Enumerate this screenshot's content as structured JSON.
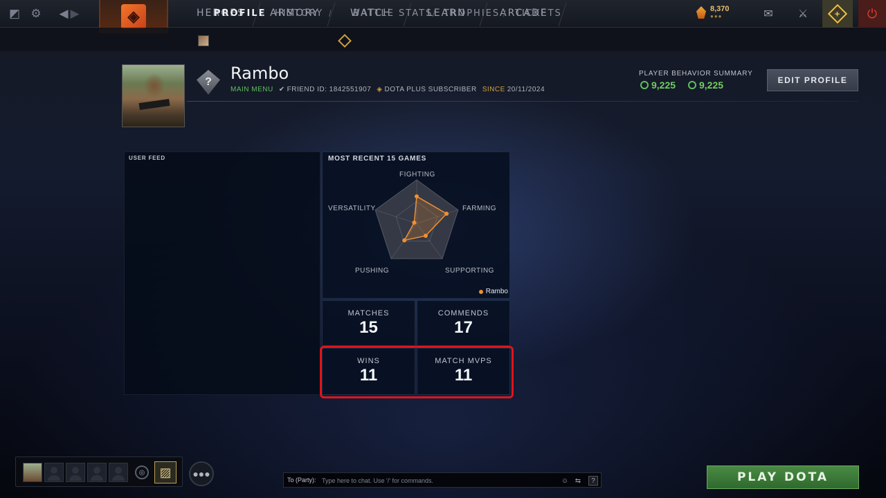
{
  "nav": {
    "items": [
      "HEROES",
      "ARMORY",
      "WATCH",
      "LEARN",
      "ARCADE"
    ],
    "currency": "8,370",
    "icons": [
      "dota-logo-icon",
      "settings-gear-icon",
      "back-arrow-icon",
      "forward-arrow-icon",
      "mail-icon",
      "armory-icon",
      "dota-plus-icon",
      "power-icon"
    ]
  },
  "subnav": {
    "profile": "PROFILE",
    "history": "HISTORY",
    "battle_stats": "BATTLE STATS",
    "trophies": "TROPHIES",
    "tickets": "TICKETS"
  },
  "profile": {
    "name": "Rambo",
    "status": "MAIN MENU",
    "friend_id": "FRIEND ID: 1842551907",
    "plus": "DOTA PLUS SUBSCRIBER",
    "since_label": "SINCE",
    "since_date": "20/11/2024",
    "rank_icon": "unknown-rank-medal-icon",
    "behavior_label": "PLAYER BEHAVIOR SUMMARY",
    "behavior_value_1": "9,225",
    "behavior_value_2": "9,225",
    "edit_button": "EDIT PROFILE"
  },
  "feed": {
    "title": "USER FEED"
  },
  "radar": {
    "title": "MOST RECENT 15 GAMES",
    "axes": [
      "FIGHTING",
      "FARMING",
      "SUPPORTING",
      "PUSHING",
      "VERSATILITY"
    ],
    "values": [
      0.62,
      0.72,
      0.35,
      0.48,
      0.06
    ],
    "legend": "Rambo",
    "series_color": "#f09030"
  },
  "stats": {
    "matches_label": "MATCHES",
    "matches_value": "15",
    "commends_label": "COMMENDS",
    "commends_value": "17",
    "wins_label": "WINS",
    "wins_value": "11",
    "mvps_label": "MATCH MVPS",
    "mvps_value": "11"
  },
  "chat": {
    "prefix": "To (Party):",
    "placeholder": "Type here to chat. Use '/' for commands."
  },
  "play_button": "PLAY DOTA",
  "colors": {
    "accent_green": "#5fbf5f",
    "gold": "#d0a040",
    "highlight_red": "#e0141a"
  }
}
